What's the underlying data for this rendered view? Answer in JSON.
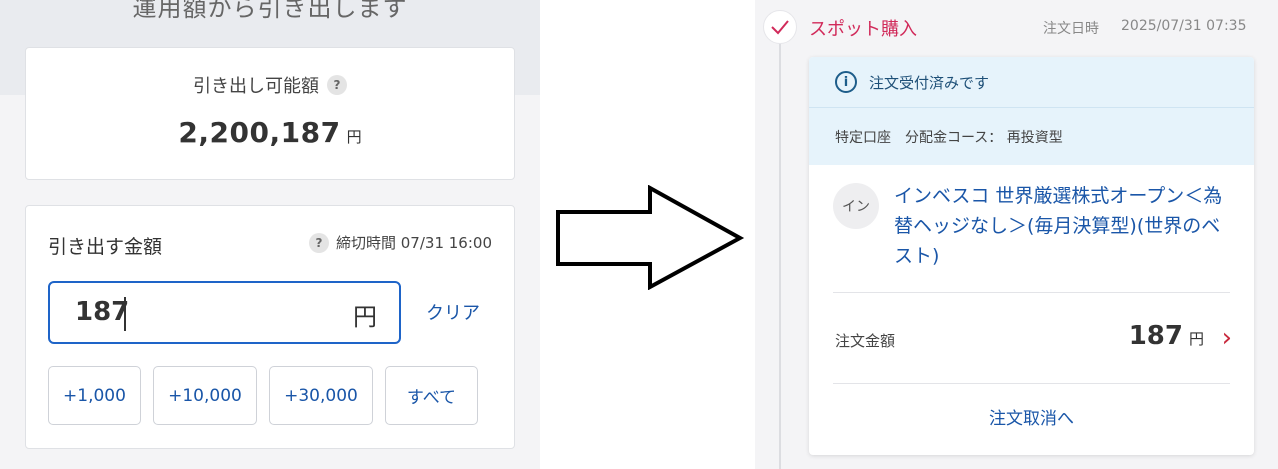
{
  "left": {
    "section_title": "運用額から引き出します",
    "available": {
      "label": "引き出し可能額",
      "help": "?",
      "amount": "2,200,187",
      "unit": "円"
    },
    "withdraw": {
      "title": "引き出す金額",
      "help": "?",
      "deadline": "締切時間 07/31 16:00",
      "input_value": "187",
      "input_unit": "円",
      "clear_label": "クリア",
      "quick_buttons": [
        "+1,000",
        "+10,000",
        "+30,000",
        "すべて"
      ]
    }
  },
  "right": {
    "status_title": "スポット購入",
    "order_date_label": "注文日時",
    "order_date_value": "2025/07/31 07:35",
    "notice": "注文受付済みです",
    "info_glyph": "i",
    "account_info": "特定口座　分配金コース： 再投資型",
    "fund_badge": "イン",
    "fund_name": "インベスコ 世界厳選株式オープン＜為替ヘッジなし＞(毎月決算型)(世界のベスト)",
    "amount_label": "注文金額",
    "amount_value": "187",
    "amount_unit": "円",
    "chevron": "›",
    "cancel_label": "注文取消へ"
  },
  "colors": {
    "accent_blue": "#1a56a8",
    "input_border": "#1e64c8",
    "spot_red": "#d12a5a",
    "notice_bg": "#e6f3fb"
  },
  "icons": [
    "help-icon",
    "check-icon",
    "info-icon",
    "chevron-right-icon",
    "right-arrow-icon"
  ]
}
